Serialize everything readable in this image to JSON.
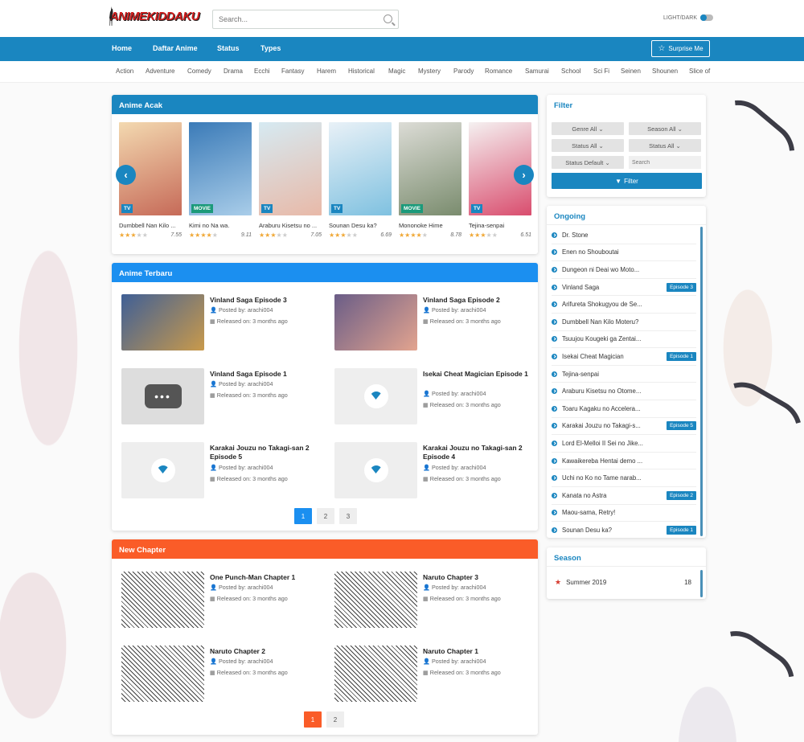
{
  "header": {
    "logo_text": "ANIMEKIDDAKU",
    "search_placeholder": "Search...",
    "theme_label": "LIGHT/DARK"
  },
  "nav": {
    "items": [
      "Home",
      "Daftar Anime",
      "Status",
      "Types"
    ],
    "surprise": "Surprise Me"
  },
  "genres": [
    "Action",
    "Adventure",
    "Comedy",
    "Drama",
    "Ecchi",
    "Fantasy",
    "Harem",
    "Historical",
    "Magic",
    "Mystery",
    "Parody",
    "Romance",
    "Samurai",
    "School",
    "Sci Fi",
    "Seinen",
    "Shounen",
    "Slice of"
  ],
  "anime_acak": {
    "title": "Anime Acak",
    "cards": [
      {
        "title": "Dumbbell Nan Kilo ...",
        "type": "TV",
        "score": "7.55",
        "stars": 3,
        "color1": "#f3d9b0",
        "color2": "#c66a58"
      },
      {
        "title": "Kimi no Na wa.",
        "type": "MOVIE",
        "score": "9.11",
        "stars": 4,
        "color1": "#3b7bb8",
        "color2": "#a9cde9"
      },
      {
        "title": "Araburu Kisetsu no ...",
        "type": "TV",
        "score": "7.05",
        "stars": 3,
        "color1": "#d6eaf2",
        "color2": "#e8b9a8"
      },
      {
        "title": "Sounan Desu ka?",
        "type": "TV",
        "score": "6.69",
        "stars": 3,
        "color1": "#e9f1f7",
        "color2": "#7fc1e0"
      },
      {
        "title": "Mononoke Hime",
        "type": "MOVIE",
        "score": "8.78",
        "stars": 4,
        "color1": "#dcdcd6",
        "color2": "#7a8c6e"
      },
      {
        "title": "Tejina-senpai",
        "type": "TV",
        "score": "6.51",
        "stars": 3,
        "color1": "#f5f1f1",
        "color2": "#d94d6e"
      }
    ]
  },
  "anime_terbaru": {
    "title": "Anime Terbaru",
    "posts": [
      {
        "title": "Vinland Saga Episode 3",
        "by": "Posted by: arachi004",
        "rel": "Released on: 3 months ago"
      },
      {
        "title": "Vinland Saga Episode 2",
        "by": "Posted by: arachi004",
        "rel": "Released on: 3 months ago"
      },
      {
        "title": "Vinland Saga Episode 1",
        "by": "Posted by: arachi004",
        "rel": "Released on: 3 months ago"
      },
      {
        "title": "Isekai Cheat Magician Episode 1",
        "by": "Posted by: arachi004",
        "rel": "Released on: 3 months ago"
      },
      {
        "title": "Karakai Jouzu no Takagi-san 2 Episode 5",
        "by": "Posted by: arachi004",
        "rel": "Released on: 3 months ago"
      },
      {
        "title": "Karakai Jouzu no Takagi-san 2 Episode 4",
        "by": "Posted by: arachi004",
        "rel": "Released on: 3 months ago"
      }
    ],
    "pages": [
      "1",
      "2",
      "3"
    ]
  },
  "new_chapter": {
    "title": "New Chapter",
    "posts": [
      {
        "title": "One Punch-Man Chapter 1",
        "by": "Posted by: arachi004",
        "rel": "Released on: 3 months ago"
      },
      {
        "title": "Naruto Chapter 3",
        "by": "Posted by: arachi004",
        "rel": "Released on: 3 months ago"
      },
      {
        "title": "Naruto Chapter 2",
        "by": "Posted by: arachi004",
        "rel": "Released on: 3 months ago"
      },
      {
        "title": "Naruto Chapter 1",
        "by": "Posted by: arachi004",
        "rel": "Released on: 3 months ago"
      }
    ],
    "pages": [
      "1",
      "2"
    ]
  },
  "filter": {
    "title": "Filter",
    "genre": "Genre All",
    "season": "Season All",
    "status": "Status All",
    "status2": "Status All",
    "order": "Status Default",
    "search_placeholder": "Search",
    "button": "Filter"
  },
  "ongoing": {
    "title": "Ongoing",
    "items": [
      {
        "name": "Dr. Stone",
        "ep": ""
      },
      {
        "name": "Enen no Shouboutai",
        "ep": ""
      },
      {
        "name": "Dungeon ni Deai wo Moto...",
        "ep": ""
      },
      {
        "name": "Vinland Saga",
        "ep": "Episode 3"
      },
      {
        "name": "Arifureta Shokugyou de Se...",
        "ep": ""
      },
      {
        "name": "Dumbbell Nan Kilo Moteru?",
        "ep": ""
      },
      {
        "name": "Tsuujou Kougeki ga Zentai...",
        "ep": ""
      },
      {
        "name": "Isekai Cheat Magician",
        "ep": "Episode 1"
      },
      {
        "name": "Tejina-senpai",
        "ep": ""
      },
      {
        "name": "Araburu Kisetsu no Otome...",
        "ep": ""
      },
      {
        "name": "Toaru Kagaku no Accelera...",
        "ep": ""
      },
      {
        "name": "Karakai Jouzu no Takagi-s...",
        "ep": "Episode 5"
      },
      {
        "name": "Lord El-Melloi II Sei no Jike...",
        "ep": ""
      },
      {
        "name": "Kawaikereba Hentai demo ...",
        "ep": ""
      },
      {
        "name": "Uchi no Ko no Tame narab...",
        "ep": ""
      },
      {
        "name": "Kanata no Astra",
        "ep": "Episode 2"
      },
      {
        "name": "Maou-sama, Retry!",
        "ep": ""
      },
      {
        "name": "Sounan Desu ka?",
        "ep": "Episode 1"
      }
    ]
  },
  "season": {
    "title": "Season",
    "name": "Summer 2019",
    "count": "18"
  },
  "colors": {
    "primary": "#1a86c0",
    "terbaru": "#1b8ff0",
    "chapter": "#fa5c28",
    "star": "#f0a836"
  }
}
